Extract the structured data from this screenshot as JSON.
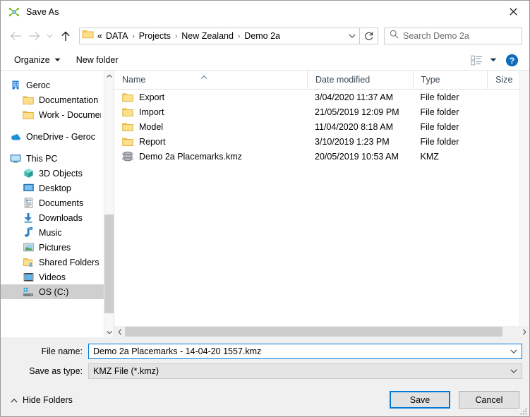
{
  "window": {
    "title": "Save As",
    "app_icon": "google-earth-icon",
    "close_label": "✕"
  },
  "navbar": {
    "back": "back-arrow",
    "forward": "forward-arrow",
    "recent": "recent-locations-caret",
    "up": "up-arrow",
    "address": {
      "folder_icon": "folder-icon",
      "prefix": "«",
      "crumbs": [
        "DATA",
        "Projects",
        "New Zealand",
        "Demo 2a"
      ],
      "separator": "›",
      "dropdown": "chevron-down-icon"
    },
    "refresh": "refresh-icon",
    "search": {
      "placeholder": "Search Demo 2a",
      "value": "",
      "icon": "search-icon"
    }
  },
  "commandbar": {
    "organize": "Organize",
    "new_folder": "New folder",
    "view_layout": "view-layout-icon",
    "view_caret": "chevron-down-icon",
    "help": "help-icon"
  },
  "sidebar": {
    "groups": [
      {
        "items": [
          {
            "label": "Geroc",
            "icon": "organization-icon",
            "level": 0,
            "selected": false
          },
          {
            "label": "Documentation",
            "icon": "folder-icon",
            "level": 1,
            "selected": false
          },
          {
            "label": "Work - Documents",
            "icon": "folder-icon",
            "level": 1,
            "selected": false
          }
        ]
      },
      {
        "items": [
          {
            "label": "OneDrive - Geroc",
            "icon": "onedrive-icon",
            "level": 0,
            "selected": false
          }
        ]
      },
      {
        "items": [
          {
            "label": "This PC",
            "icon": "this-pc-icon",
            "level": 0,
            "selected": false
          },
          {
            "label": "3D Objects",
            "icon": "3d-objects-icon",
            "level": 1,
            "selected": false
          },
          {
            "label": "Desktop",
            "icon": "desktop-icon",
            "level": 1,
            "selected": false
          },
          {
            "label": "Documents",
            "icon": "documents-icon",
            "level": 1,
            "selected": false
          },
          {
            "label": "Downloads",
            "icon": "downloads-icon",
            "level": 1,
            "selected": false
          },
          {
            "label": "Music",
            "icon": "music-icon",
            "level": 1,
            "selected": false
          },
          {
            "label": "Pictures",
            "icon": "pictures-icon",
            "level": 1,
            "selected": false
          },
          {
            "label": "Shared Folders",
            "icon": "shared-folder-icon",
            "level": 1,
            "selected": false
          },
          {
            "label": "Videos",
            "icon": "videos-icon",
            "level": 1,
            "selected": false
          },
          {
            "label": "OS (C:)",
            "icon": "hard-drive-icon",
            "level": 1,
            "selected": true
          }
        ]
      }
    ]
  },
  "filelist": {
    "columns": [
      {
        "label": "Name",
        "sorted": "ascending"
      },
      {
        "label": "Date modified",
        "sorted": ""
      },
      {
        "label": "Type",
        "sorted": ""
      },
      {
        "label": "Size",
        "sorted": ""
      }
    ],
    "rows": [
      {
        "name": "Export",
        "date": "3/04/2020 11:37 AM",
        "type": "File folder",
        "size": "",
        "icon": "folder-icon"
      },
      {
        "name": "Import",
        "date": "21/05/2019 12:09 PM",
        "type": "File folder",
        "size": "",
        "icon": "folder-icon"
      },
      {
        "name": "Model",
        "date": "11/04/2020 8:18 AM",
        "type": "File folder",
        "size": "",
        "icon": "folder-icon"
      },
      {
        "name": "Report",
        "date": "3/10/2019 1:23 PM",
        "type": "File folder",
        "size": "",
        "icon": "folder-icon"
      },
      {
        "name": "Demo 2a Placemarks.kmz",
        "date": "20/05/2019 10:53 AM",
        "type": "KMZ",
        "size": "",
        "icon": "kmz-globe-icon"
      }
    ]
  },
  "form": {
    "filename_label": "File name:",
    "filename_value": "Demo 2a Placemarks - 14-04-20 1557.kmz",
    "filetype_label": "Save as type:",
    "filetype_value": "KMZ File (*.kmz)",
    "caret_icon": "chevron-down-icon"
  },
  "footer": {
    "hide_folders": "Hide Folders",
    "hide_folders_icon": "chevron-up-icon",
    "save": "Save",
    "cancel": "Cancel"
  },
  "colors": {
    "accent": "#0078d7",
    "dialog_bg": "#f0f0f0",
    "panel_bg": "#ffffff",
    "selection": "#cfcfcf",
    "folder_yellow": "#fcd769",
    "scrollbar_thumb": "#cdcdcd"
  }
}
